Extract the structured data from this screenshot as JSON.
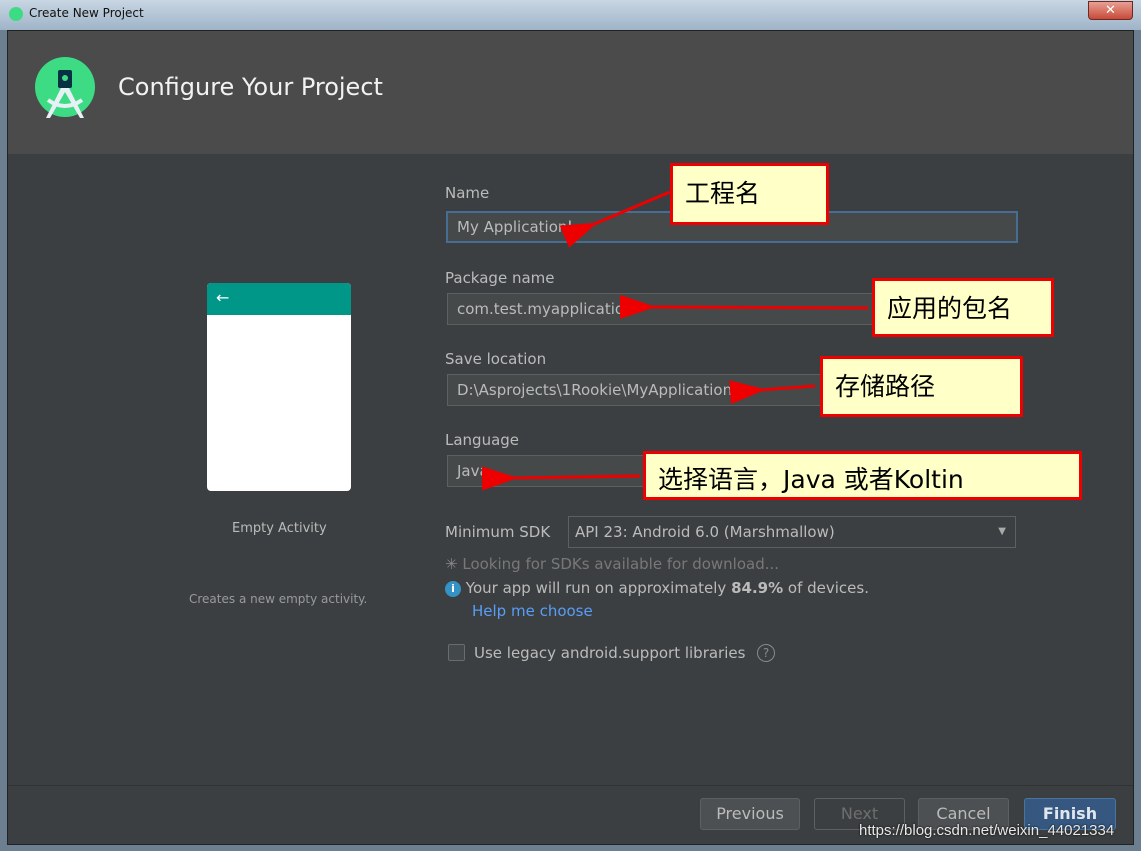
{
  "window": {
    "title": "Create New Project",
    "close_label": "✕"
  },
  "header": {
    "title": "Configure Your Project"
  },
  "template": {
    "name": "Empty Activity",
    "description": "Creates a new empty activity.",
    "back_arrow": "←"
  },
  "form": {
    "name": {
      "label": "Name",
      "value": "My Application"
    },
    "package": {
      "label": "Package name",
      "value": "com.test.myapplication"
    },
    "location": {
      "label": "Save location",
      "value": "D:\\Asprojects\\1Rookie\\MyApplication"
    },
    "language": {
      "label": "Language",
      "value": "Java"
    },
    "min_sdk": {
      "label": "Minimum SDK",
      "value": "API 23: Android 6.0 (Marshmallow)"
    },
    "loading": "Looking for SDKs available for download...",
    "info_prefix": "Your app will run on approximately ",
    "info_percent": "84.9%",
    "info_suffix": " of devices.",
    "help_link": "Help me choose",
    "legacy_label": "Use legacy android.support libraries",
    "legacy_checked": false
  },
  "buttons": {
    "previous": "Previous",
    "next": "Next",
    "cancel": "Cancel",
    "finish": "Finish"
  },
  "annotations": [
    "工程名",
    "应用的包名",
    "存储路径",
    "选择语言，Java 或者Koltin"
  ],
  "watermark": "https://blog.csdn.net/weixin_44021334",
  "colors": {
    "accent": "#466d94",
    "link": "#589df6",
    "finish": "#365880",
    "annotation_border": "#ee0000",
    "annotation_bg": "#ffffc8"
  }
}
